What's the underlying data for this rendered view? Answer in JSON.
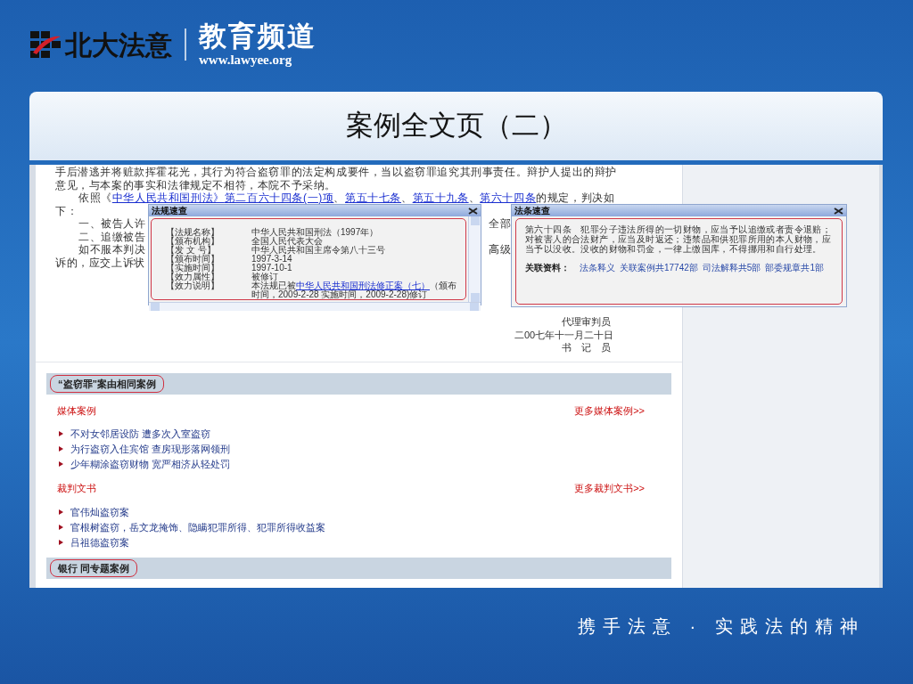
{
  "logo": {
    "brand": "北大法意",
    "channel": "教育频道",
    "url": "www.lawyee.org"
  },
  "slide_title": "案例全文页（二）",
  "judgment": [
    {
      "kind": "cont",
      "segments": [
        {
          "text": "手后潜逃并将赃款挥霍花光，其行为符合盗窃罪的法定构成要件，当以盗窃罪追究其刑事责任。辩护人提出的辩护",
          "link": false
        }
      ]
    },
    {
      "kind": "cont",
      "segments": [
        {
          "text": "意见，与本案的事实和法律规定不相符，本院不予采纳。",
          "link": false
        }
      ]
    },
    {
      "kind": "para",
      "segments": [
        {
          "text": "依照《",
          "link": false
        },
        {
          "text": "中华人民共和国刑法》",
          "link": true
        },
        {
          "text": "第二百六十四条(一)项",
          "link": true
        },
        {
          "text": "、",
          "link": false
        },
        {
          "text": "第五十七条",
          "link": true
        },
        {
          "text": "、",
          "link": false
        },
        {
          "text": "第五十九条",
          "link": true
        },
        {
          "text": "、",
          "link": false
        },
        {
          "text": "第六十四条",
          "link": true
        },
        {
          "text": "的规定，判决如",
          "link": false
        }
      ]
    },
    {
      "kind": "cont",
      "segments": [
        {
          "text": "下：",
          "link": false
        }
      ]
    },
    {
      "kind": "para",
      "segments": [
        {
          "text": "一、被告人许",
          "link": false
        }
      ],
      "tail": "全部"
    },
    {
      "kind": "para",
      "segments": [
        {
          "text": "二、追缴被告",
          "link": false
        }
      ]
    },
    {
      "kind": "para",
      "segments": [
        {
          "text": "如不服本判决",
          "link": false
        }
      ],
      "tail": "高级"
    },
    {
      "kind": "cont",
      "segments": [
        {
          "text": "诉的，应交上诉状",
          "link": false
        }
      ]
    }
  ],
  "signatures": [
    "代理审判员",
    "二00七年十一月二十日",
    "书　记　员"
  ],
  "popups": [
    {
      "kind": "statute",
      "title": "法规速查",
      "rows": [
        {
          "label": "【法规名称】",
          "value": [
            {
              "text": "中华人民共和国刑法（1997年）",
              "link": false
            }
          ]
        },
        {
          "label": "【颁布机构】",
          "value": [
            {
              "text": "全国人民代表大会",
              "link": false
            }
          ]
        },
        {
          "label": "【发 文 号】",
          "value": [
            {
              "text": "中华人民共和国主席令第八十三号",
              "link": false
            }
          ]
        },
        {
          "label": "【颁布时间】",
          "value": [
            {
              "text": "1997-3-14",
              "link": false
            }
          ]
        },
        {
          "label": "【实施时间】",
          "value": [
            {
              "text": "1997-10-1",
              "link": false
            }
          ]
        },
        {
          "label": "【效力属性】",
          "value": [
            {
              "text": "被修订",
              "link": false
            }
          ]
        },
        {
          "label": "【效力说明】",
          "value": [
            {
              "text": "本法规已被",
              "link": false
            },
            {
              "text": "中华人民共和国刑法修正案（七）",
              "link": true
            },
            {
              "text": "（颁布时间，2009-2-28 实施时间，2009-2-28)修订",
              "link": false
            }
          ]
        }
      ]
    },
    {
      "kind": "article",
      "title": "法条速查",
      "text": "第六十四条　犯罪分子违法所得的一切财物，应当予以追缴或者责令退赔；对被害人的合法财产，应当及时返还；违禁品和供犯罪所用的本人财物，应当予以没收。没收的财物和罚金，一律上缴国库，不得挪用和自行处理。",
      "related_label": "关联资料：",
      "related": [
        "法条释义",
        "关联案例共17742部",
        "司法解释共5部",
        "部委规章共1部"
      ]
    }
  ],
  "sections": [
    {
      "title": "“盗窃罪”案由相同案例",
      "groups": [
        {
          "heading": "媒体案例",
          "more": "更多媒体案例>>",
          "items": [
            "不对女邻居设防 遭多次入室盗窃",
            "为行盗窃入住宾馆 查房现形落网领刑",
            "少年糊涂盗窃财物 宽严相济从轻处罚"
          ]
        },
        {
          "heading": "裁判文书",
          "more": "更多裁判文书>>",
          "items": [
            "官伟灿盗窃案",
            "官根树盗窃，岳文龙掩饰、隐瞒犯罪所得、犯罪所得收益案",
            "吕祖德盗窃案"
          ]
        }
      ]
    },
    {
      "title": "银行 同专题案例"
    }
  ],
  "slogan": "携手法意 · 实践法的精神"
}
